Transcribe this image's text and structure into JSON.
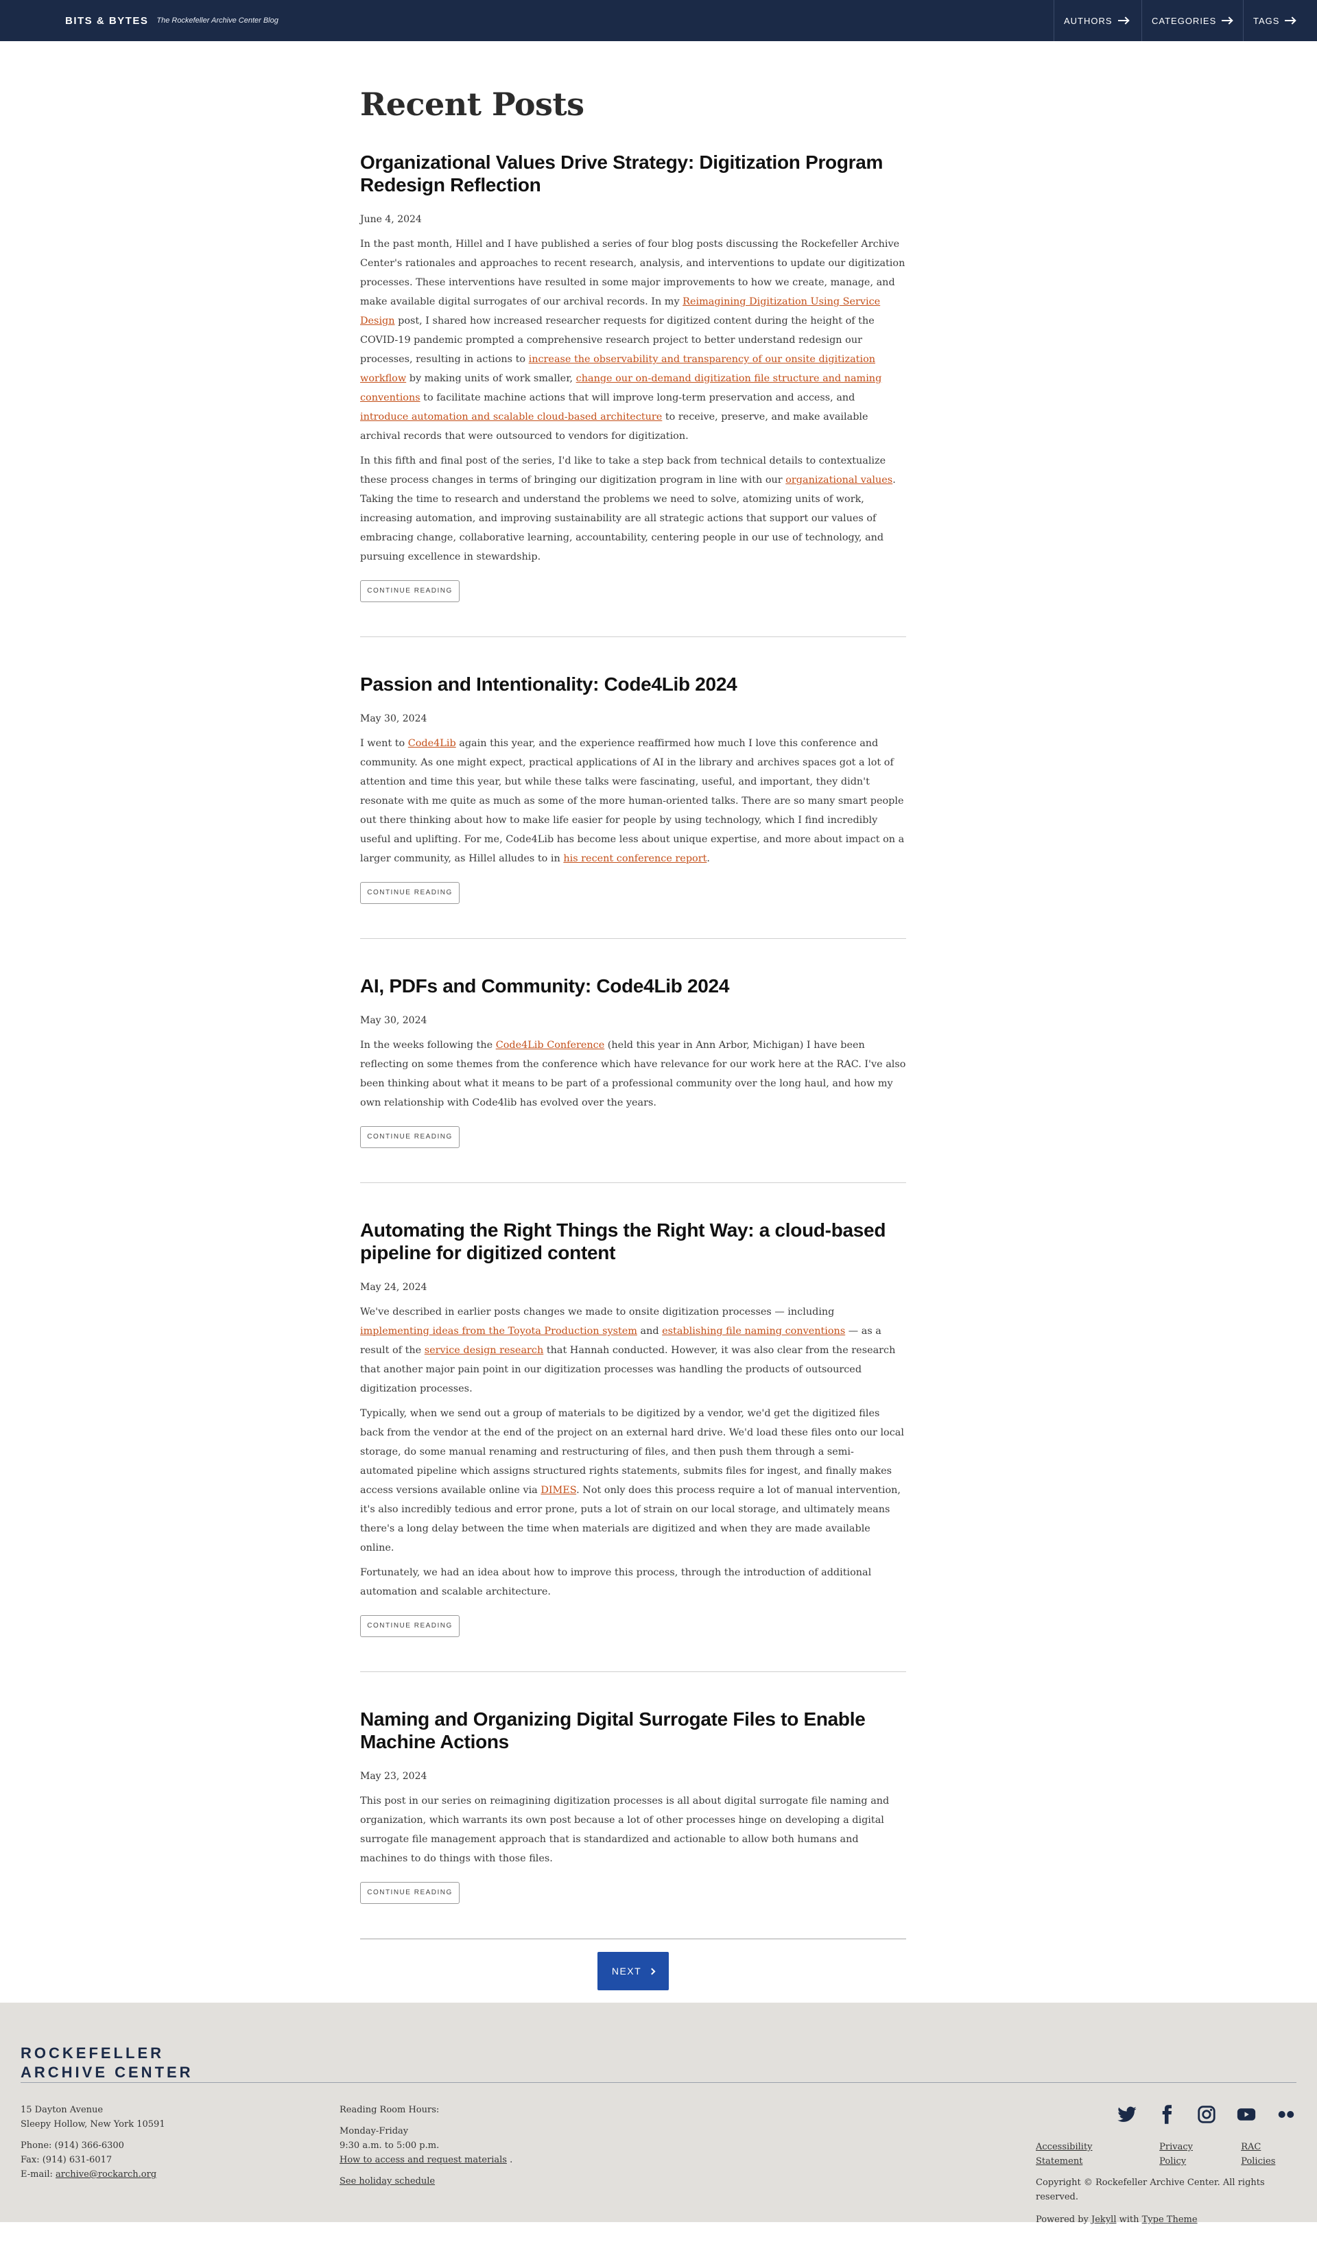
{
  "header": {
    "site_name": "BITS & BYTES",
    "tagline": "The Rockefeller Archive Center Blog",
    "nav": [
      {
        "label": "AUTHORS"
      },
      {
        "label": "CATEGORIES"
      },
      {
        "label": "TAGS"
      }
    ]
  },
  "page_title": "Recent Posts",
  "continue_label": "CONTINUE READING",
  "posts": [
    {
      "title": "Organizational Values Drive Strategy: Digitization Program Redesign Reflection",
      "date": "June 4, 2024",
      "p1": {
        "t1": "In the past month, Hillel and I have published a series of four blog posts discussing the Rockefeller Archive Center's rationales and approaches to recent research, analysis, and interventions to update our digitization processes. These interventions have resulted in some major improvements to how we create, manage, and make available digital surrogates of our archival records. In my ",
        "l1": "Reimagining Digitization Using Service Design",
        "t2": " post, I shared how increased researcher requests for digitized content during the height of the COVID-19 pandemic prompted a comprehensive research project to better understand redesign our processes, resulting in actions to ",
        "l2": "increase the observability and transparency of our onsite digitization workflow",
        "t3": " by making units of work smaller, ",
        "l3": "change our on-demand digitization file structure and naming conventions",
        "t4": " to facilitate machine actions that will improve long-term preservation and access, and ",
        "l4": "introduce automation and scalable cloud-based architecture",
        "t5": " to receive, preserve, and make available archival records that were outsourced to vendors for digitization."
      },
      "p2": {
        "t1": "In this fifth and final post of the series, I'd like to take a step back from technical details to contextualize these process changes in terms of bringing our digitization program in line with our ",
        "l1": "organizational values",
        "t2": ". Taking the time to research and understand the problems we need to solve, atomizing units of work, increasing automation, and improving sustainability are all strategic actions that support our values of embracing change, collaborative learning, accountability, centering people in our use of technology, and pursuing excellence in stewardship."
      }
    },
    {
      "title": "Passion and Intentionality: Code4Lib 2024",
      "date": "May 30, 2024",
      "p1": {
        "t1": "I went to ",
        "l1": "Code4Lib",
        "t2": " again this year, and the experience reaffirmed how much I love this conference and community. As one might expect, practical applications of AI in the library and archives spaces got a lot of attention and time this year, but while these talks were fascinating, useful, and important, they didn't resonate with me quite as much as some of the more human-oriented talks. There are so many smart people out there thinking about how to make life easier for people by using technology, which I find incredibly useful and uplifting. For me, Code4Lib has become less about unique expertise, and more about impact on a larger community, as Hillel alludes to in ",
        "l2": "his recent conference report",
        "t3": "."
      }
    },
    {
      "title": "AI, PDFs and Community: Code4Lib 2024",
      "date": "May 30, 2024",
      "p1": {
        "t1": "In the weeks following the ",
        "l1": "Code4Lib Conference",
        "t2": " (held this year in Ann Arbor, Michigan) I have been reflecting on some themes from the conference which have relevance for our work here at the RAC. I've also been thinking about what it means to be part of a professional community over the long haul, and how my own relationship with Code4lib has evolved over the years."
      }
    },
    {
      "title": "Automating the Right Things the Right Way: a cloud-based pipeline for digitized content",
      "date": "May 24, 2024",
      "p1": {
        "t1": "We've described in earlier posts changes we made to onsite digitization processes — including ",
        "l1": "implementing ideas from the Toyota Production system",
        "t2": " and ",
        "l2": "establishing file naming conventions",
        "t3": " — as a result of the ",
        "l3": "service design research",
        "t4": " that Hannah conducted. However, it was also clear from the research that another major pain point in our digitization processes was handling the products of outsourced digitization processes."
      },
      "p2": {
        "t1": "Typically, when we send out a group of materials to be digitized by a vendor, we'd get the digitized files back from the vendor at the end of the project on an external hard drive. We'd load these files onto our local storage, do some manual renaming and restructuring of files, and then push them through a semi-automated pipeline which assigns structured rights statements, submits files for ingest, and finally makes access versions available online via ",
        "l1": "DIMES",
        "t2": ". Not only does this process require a lot of manual intervention, it's also incredibly tedious and error prone, puts a lot of strain on our local storage, and ultimately means there's a long delay between the time when materials are digitized and when they are made available online."
      },
      "p3": "Fortunately, we had an idea about how to improve this process, through the introduction of additional automation and scalable architecture."
    },
    {
      "title": "Naming and Organizing Digital Surrogate Files to Enable Machine Actions",
      "date": "May 23, 2024",
      "p1": {
        "t1": "This post in our series on reimagining digitization processes is all about digital surrogate file naming and organization, which warrants its own post because a lot of other processes hinge on developing a digital surrogate file management approach that is standardized and actionable to allow both humans and machines to do things with those files."
      }
    }
  ],
  "pager": {
    "next_label": "NEXT"
  },
  "footer": {
    "logo_line1": "ROCKEFELLER",
    "logo_line2": "ARCHIVE CENTER",
    "address1": "15 Dayton Avenue",
    "address2": "Sleepy Hollow, New York 10591",
    "phone": "Phone: (914) 366-6300",
    "fax": "Fax: (914) 631-6017",
    "email_label": "E-mail: ",
    "email": "archive@rockarch.org",
    "hours_title": "Reading Room Hours:",
    "hours_days": "Monday-Friday",
    "hours_time": "9:30 a.m. to 5:00 p.m.",
    "access_link": "How to access and request materials",
    "access_suffix": " .",
    "holiday_link": "See holiday schedule",
    "social": [
      "twitter-icon",
      "facebook-icon",
      "instagram-icon",
      "youtube-icon",
      "flickr-icon"
    ],
    "legal_links": [
      "Accessibility Statement",
      "Privacy Policy",
      "RAC Policies"
    ],
    "copyright": "Copyright © Rockefeller Archive Center. All rights reserved.",
    "powered_prefix": "Powered by ",
    "powered_jekyll": "Jekyll",
    "powered_with": " with ",
    "powered_theme": "Type Theme"
  }
}
